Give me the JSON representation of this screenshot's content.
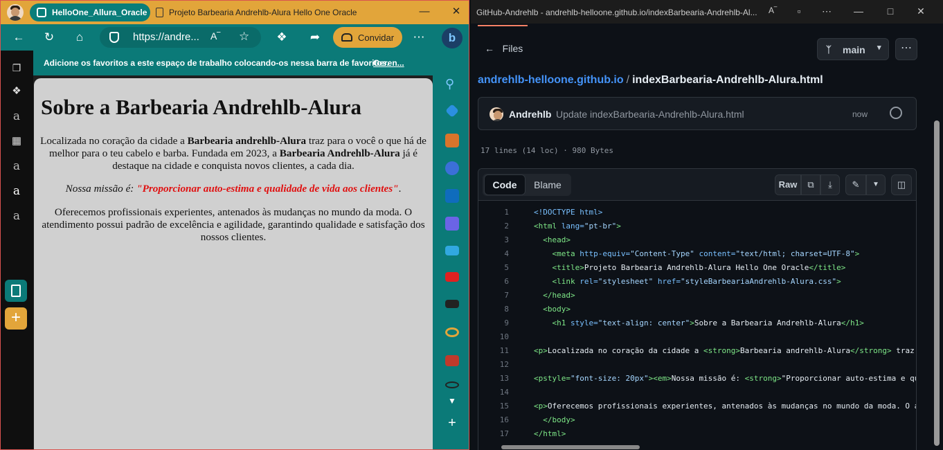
{
  "left": {
    "workspace_label": "HelloOne_Allura_Oracle",
    "active_tab_title": "Projeto Barbearia Andrehlb-Alura Hello One Oracle",
    "address_url": "https://andre...",
    "invite_label": "Convidar",
    "favorites_message": "Adicione os favoritos a este espaço de trabalho colocando-os nessa barra de favoritos.",
    "favorites_manage_link": "Geren...",
    "page": {
      "heading": "Sobre a Barbearia Andrehlb-Alura",
      "p1_a": "Localizada no coração da cidade a ",
      "p1_strong1": "Barbearia andrehlb-Alura",
      "p1_b": " traz para o você o que há de melhor para o teu cabelo e barba. Fundada em 2023, a ",
      "p1_strong2": "Barbearia Andrehlb-Alura",
      "p1_c": " já é destaque na cidade e conquista novos clientes, a cada dia.",
      "p2_em": "Nossa missão é: ",
      "p2_red": "\"Proporcionar auto-estima e qualidade de vida aos clientes\"",
      "p2_end": ".",
      "p3": "Oferecemos profissionais experientes, antenados às mudanças no mundo da moda. O atendimento possui padrão de excelência e agilidade, garantindo qualidade e satisfação dos nossos clientes."
    },
    "colors": {
      "teal": "#0b7a78",
      "gold": "#e2a53a",
      "emphasis_red": "#e01010"
    }
  },
  "right": {
    "window_title": "GitHub-Andrehlb - andrehlb-helloone.github.io/indexBarbearia-Andrehlb-Al...",
    "files_label": "Files",
    "branch": "main",
    "repo_link": "andrehlb-helloone.github.io",
    "breadcrumb_sep": "/",
    "file_name": "indexBarbearia-Andrehlb-Alura.html",
    "commit_author": "Andrehlb",
    "commit_message": "Update indexBarbearia-Andrehlb-Alura.html",
    "commit_time": "now",
    "file_info": "17 lines (14 loc) · 980 Bytes",
    "tab_code": "Code",
    "tab_blame": "Blame",
    "raw_label": "Raw",
    "line_numbers": [
      "1",
      "2",
      "3",
      "4",
      "5",
      "6",
      "7",
      "8",
      "9",
      "10",
      "11",
      "12",
      "13",
      "14",
      "15",
      "16",
      "17"
    ],
    "code": {
      "l1": "<!DOCTYPE html>",
      "l2_open": "<html ",
      "l2_attr": "lang=",
      "l2_val": "\"pt-br\"",
      "l2_close": ">",
      "l3": "<head>",
      "l4_tag": "<meta ",
      "l4_a1": "http-equiv=",
      "l4_v1": "\"Content-Type\"",
      "l4_a2": " content=",
      "l4_v2": "\"text/html; charset=UTF-8\"",
      "l4_close": ">",
      "l5_open": "<title>",
      "l5_text": "Projeto Barbearia Andrehlb-Alura Hello One Oracle",
      "l5_close": "</title>",
      "l6_tag": "<link ",
      "l6_a1": "rel=",
      "l6_v1": "\"stylesheet\"",
      "l6_a2": " href=",
      "l6_v2": "\"styleBarbeariaAndrehlb-Alura.css\"",
      "l6_close": ">",
      "l7": "</head>",
      "l8": "<body>",
      "l9_tag": "<h1 ",
      "l9_a": "style=",
      "l9_v": "\"text-align: center\"",
      "l9_gt": ">",
      "l9_text": "Sobre a Barbearia Andrehlb-Alura",
      "l9_close": "</h1>",
      "l11_open": "<p>",
      "l11_text": "Localizada no coração da cidade a ",
      "l11_s1": "<strong>",
      "l11_bold": "Barbearia andrehlb-Alura",
      "l11_s2": "</strong>",
      "l11_rest": " traz",
      "l13_tag": "<pstyle=",
      "l13_v": "\"font-size: 20px\"",
      "l13_gt": ">",
      "l13_em": "<em>",
      "l13_text": "Nossa missão é: ",
      "l13_st": "<strong>",
      "l13_rest": "\"Proporcionar auto-estima e qu",
      "l15_open": "<p>",
      "l15_text": "Oferecemos profissionais experientes, antenados às mudanças no mundo da moda. O a",
      "l16": "</body>",
      "l17": "</html>"
    },
    "colors": {
      "bg": "#0d1117",
      "link": "#4493f8",
      "tag": "#7ee787",
      "attr": "#79c0ff",
      "string": "#a5d6ff"
    }
  }
}
